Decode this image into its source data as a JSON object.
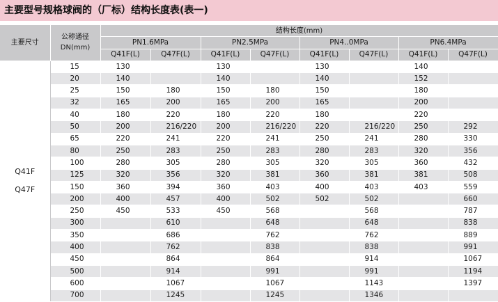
{
  "title": "主要型号规格球阀的（厂标）结构长度表(表一)",
  "header": {
    "main_size": "主要尺寸",
    "nominal_bore": "公称通径\nDN(mm)",
    "nominal_bore_line1": "公称通径",
    "nominal_bore_line2": "DN(mm)",
    "structure_length": "结构长度(mm)",
    "pressure_classes": [
      "PN1.6MPa",
      "PN2.5MPa",
      "PN4..0MPa",
      "PN6.4MPa"
    ],
    "models": [
      "Q41F(L)",
      "Q47F(L)"
    ]
  },
  "model_labels": [
    "Q41F",
    "Q47F"
  ],
  "rows": [
    {
      "dn": "15",
      "v": [
        "130",
        "",
        "130",
        "",
        "130",
        "",
        "140",
        ""
      ]
    },
    {
      "dn": "20",
      "v": [
        "140",
        "",
        "140",
        "",
        "140",
        "",
        "152",
        ""
      ]
    },
    {
      "dn": "25",
      "v": [
        "150",
        "180",
        "150",
        "180",
        "150",
        "",
        "180",
        ""
      ]
    },
    {
      "dn": "32",
      "v": [
        "165",
        "200",
        "165",
        "200",
        "165",
        "",
        "200",
        ""
      ]
    },
    {
      "dn": "40",
      "v": [
        "180",
        "220",
        "180",
        "220",
        "180",
        "",
        "220",
        ""
      ]
    },
    {
      "dn": "50",
      "v": [
        "200",
        "216/220",
        "200",
        "216/220",
        "220",
        "216/220",
        "250",
        "292"
      ]
    },
    {
      "dn": "65",
      "v": [
        "220",
        "241",
        "220",
        "241",
        "250",
        "241",
        "280",
        "330"
      ]
    },
    {
      "dn": "80",
      "v": [
        "250",
        "283",
        "250",
        "283",
        "280",
        "283",
        "320",
        "356"
      ]
    },
    {
      "dn": "100",
      "v": [
        "280",
        "305",
        "280",
        "305",
        "320",
        "305",
        "360",
        "432"
      ]
    },
    {
      "dn": "125",
      "v": [
        "320",
        "356",
        "320",
        "381",
        "360",
        "381",
        "381",
        "508"
      ]
    },
    {
      "dn": "150",
      "v": [
        "360",
        "394",
        "360",
        "403",
        "400",
        "403",
        "403",
        "559"
      ]
    },
    {
      "dn": "200",
      "v": [
        "400",
        "457",
        "400",
        "502",
        "502",
        "502",
        "",
        "660"
      ]
    },
    {
      "dn": "250",
      "v": [
        "450",
        "533",
        "450",
        "568",
        "",
        "568",
        "",
        "787"
      ]
    },
    {
      "dn": "300",
      "v": [
        "",
        "610",
        "",
        "648",
        "",
        "648",
        "",
        "838"
      ]
    },
    {
      "dn": "350",
      "v": [
        "",
        "686",
        "",
        "762",
        "",
        "762",
        "",
        "889"
      ]
    },
    {
      "dn": "400",
      "v": [
        "",
        "762",
        "",
        "838",
        "",
        "838",
        "",
        "991"
      ]
    },
    {
      "dn": "450",
      "v": [
        "",
        "864",
        "",
        "864",
        "",
        "914",
        "",
        "1067"
      ]
    },
    {
      "dn": "500",
      "v": [
        "",
        "914",
        "",
        "991",
        "",
        "991",
        "",
        "1194"
      ]
    },
    {
      "dn": "600",
      "v": [
        "",
        "1067",
        "",
        "1067",
        "",
        "1143",
        "",
        "1397"
      ]
    },
    {
      "dn": "700",
      "v": [
        "",
        "1245",
        "",
        "1245",
        "",
        "1346",
        "",
        ""
      ]
    }
  ]
}
